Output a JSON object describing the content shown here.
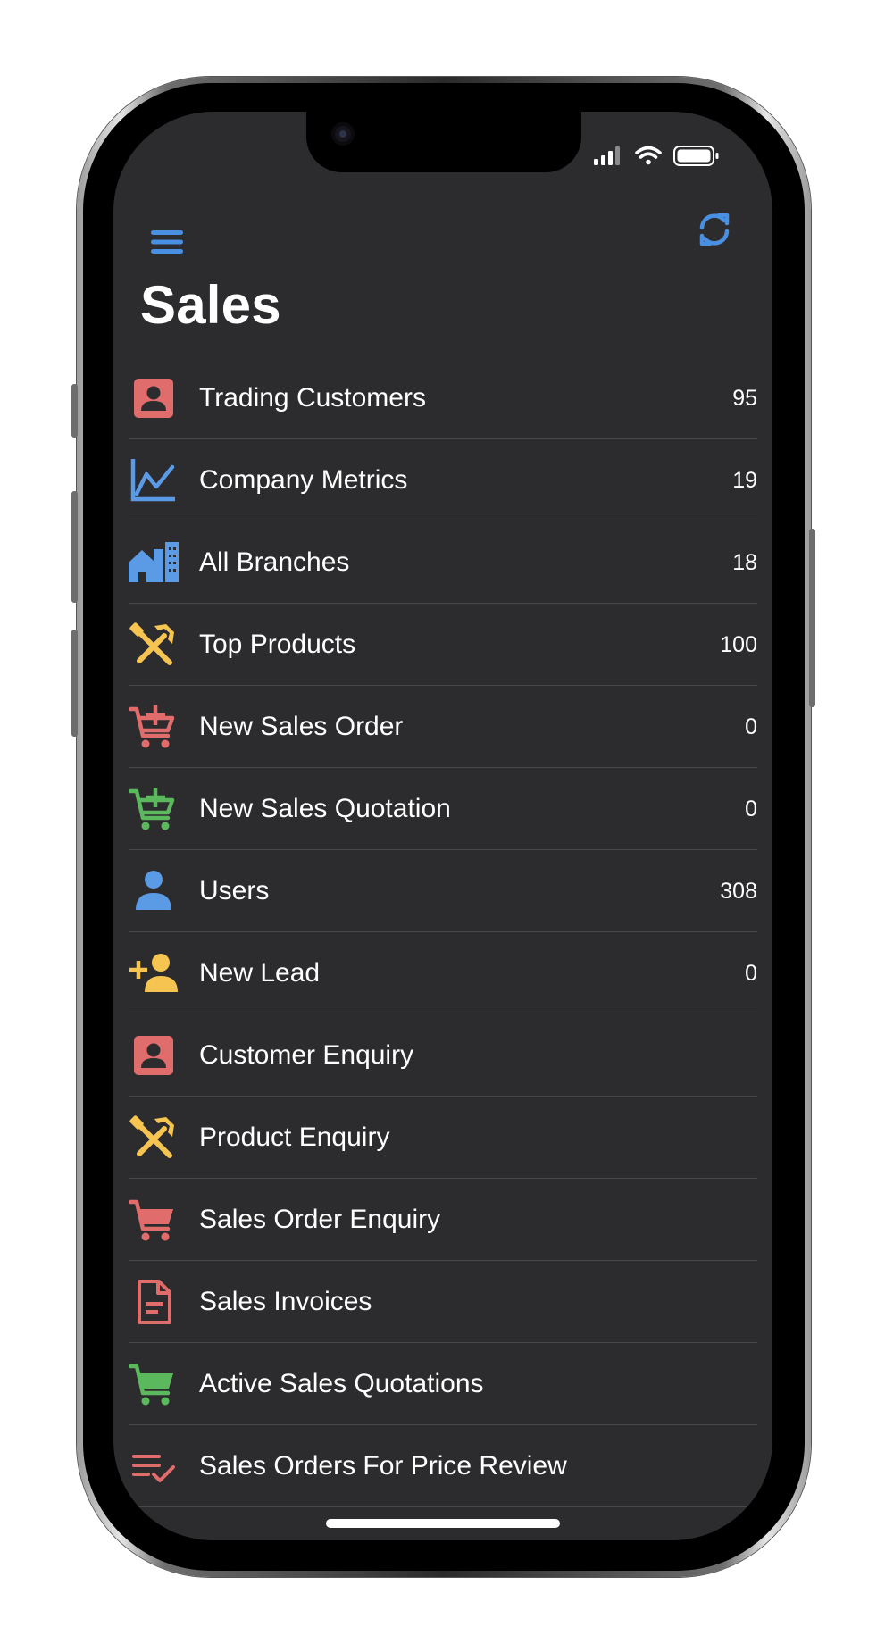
{
  "status_bar": {
    "icons": [
      "signal-icon",
      "wifi-icon",
      "battery-icon"
    ]
  },
  "nav": {
    "menu_icon": "hamburger-menu-icon",
    "refresh_icon": "refresh-icon",
    "accent": "#4a90e2"
  },
  "page": {
    "title": "Sales"
  },
  "colors": {
    "red": "#e06c6c",
    "blue": "#5b9be6",
    "yellow": "#f5c451",
    "green": "#5cb85c",
    "background": "#2c2c2e",
    "separator": "#48484a"
  },
  "items": [
    {
      "label": "Trading Customers",
      "count": "95",
      "icon": "contact-card-icon"
    },
    {
      "label": "Company Metrics",
      "count": "19",
      "icon": "line-chart-icon"
    },
    {
      "label": "All Branches",
      "count": "18",
      "icon": "branches-building-icon"
    },
    {
      "label": "Top Products",
      "count": "100",
      "icon": "tools-icon"
    },
    {
      "label": "New Sales Order",
      "count": "0",
      "icon": "cart-add-icon"
    },
    {
      "label": "New Sales Quotation",
      "count": "0",
      "icon": "cart-add-icon"
    },
    {
      "label": "Users",
      "count": "308",
      "icon": "user-icon"
    },
    {
      "label": "New Lead",
      "count": "0",
      "icon": "user-add-icon"
    },
    {
      "label": "Customer Enquiry",
      "count": "",
      "icon": "contact-card-icon"
    },
    {
      "label": "Product Enquiry",
      "count": "",
      "icon": "tools-icon"
    },
    {
      "label": "Sales Order Enquiry",
      "count": "",
      "icon": "cart-icon"
    },
    {
      "label": "Sales Invoices",
      "count": "",
      "icon": "document-icon"
    },
    {
      "label": "Active Sales Quotations",
      "count": "",
      "icon": "cart-icon"
    },
    {
      "label": "Sales Orders For Price Review",
      "count": "",
      "icon": "checklist-icon"
    }
  ]
}
